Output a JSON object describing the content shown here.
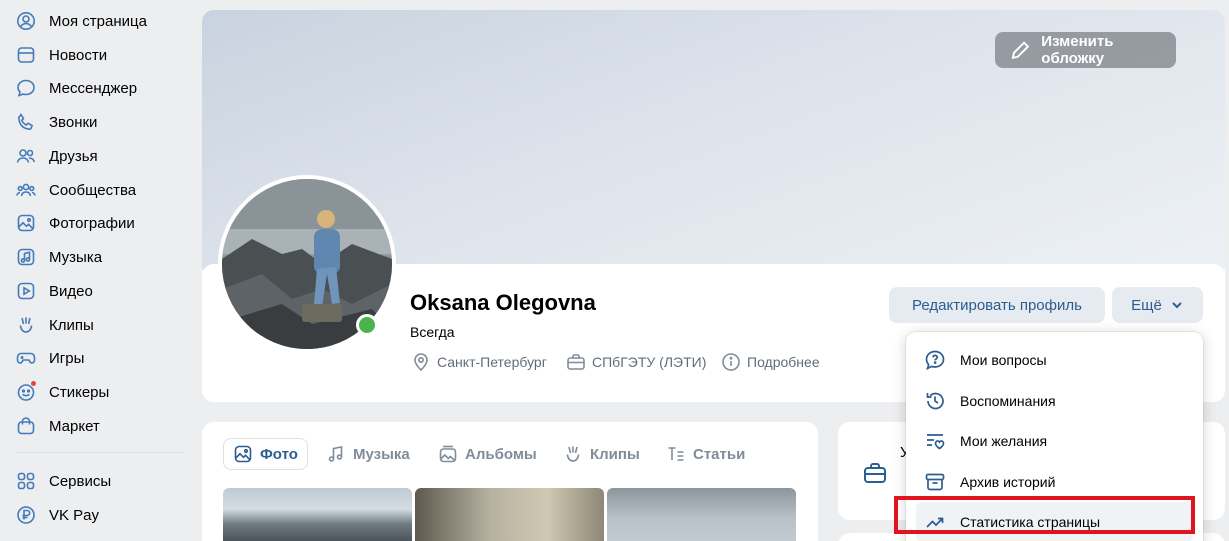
{
  "sidebar": {
    "items": [
      {
        "label": "Моя страница",
        "icon": "user-circle-icon"
      },
      {
        "label": "Новости",
        "icon": "news-icon"
      },
      {
        "label": "Мессенджер",
        "icon": "message-icon"
      },
      {
        "label": "Звонки",
        "icon": "phone-icon"
      },
      {
        "label": "Друзья",
        "icon": "friends-icon"
      },
      {
        "label": "Сообщества",
        "icon": "communities-icon"
      },
      {
        "label": "Фотографии",
        "icon": "photo-icon"
      },
      {
        "label": "Музыка",
        "icon": "music-icon"
      },
      {
        "label": "Видео",
        "icon": "video-icon"
      },
      {
        "label": "Клипы",
        "icon": "clips-icon"
      },
      {
        "label": "Игры",
        "icon": "gamepad-icon"
      },
      {
        "label": "Стикеры",
        "icon": "sticker-icon"
      },
      {
        "label": "Маркет",
        "icon": "market-icon"
      },
      {
        "label": "Сервисы",
        "icon": "services-icon"
      },
      {
        "label": "VK Pay",
        "icon": "vkpay-icon"
      }
    ]
  },
  "cover": {
    "edit_label": "Изменить обложку"
  },
  "profile": {
    "name": "Oksana Olegovna",
    "status": "Всегда",
    "city": "Санкт-Петербург",
    "university": "СПбГЭТУ (ЛЭТИ)",
    "more_info": "Подробнее",
    "edit_label": "Редактировать профиль",
    "more_label": "Ещё"
  },
  "tabs": [
    {
      "label": "Фото",
      "active": true
    },
    {
      "label": "Музыка"
    },
    {
      "label": "Альбомы"
    },
    {
      "label": "Клипы"
    },
    {
      "label": "Статьи"
    }
  ],
  "side_card": {
    "initial": "У"
  },
  "dropdown": {
    "items": [
      {
        "label": "Мои вопросы",
        "icon": "question-icon"
      },
      {
        "label": "Воспоминания",
        "icon": "history-icon"
      },
      {
        "label": "Мои желания",
        "icon": "wishlist-icon"
      },
      {
        "label": "Архив историй",
        "icon": "archive-icon"
      },
      {
        "label": "Статистика страницы",
        "icon": "statistics-icon"
      }
    ]
  },
  "colors": {
    "accent": "#2c5d8f",
    "online": "#4bb34b",
    "highlight": "#e1131f"
  }
}
